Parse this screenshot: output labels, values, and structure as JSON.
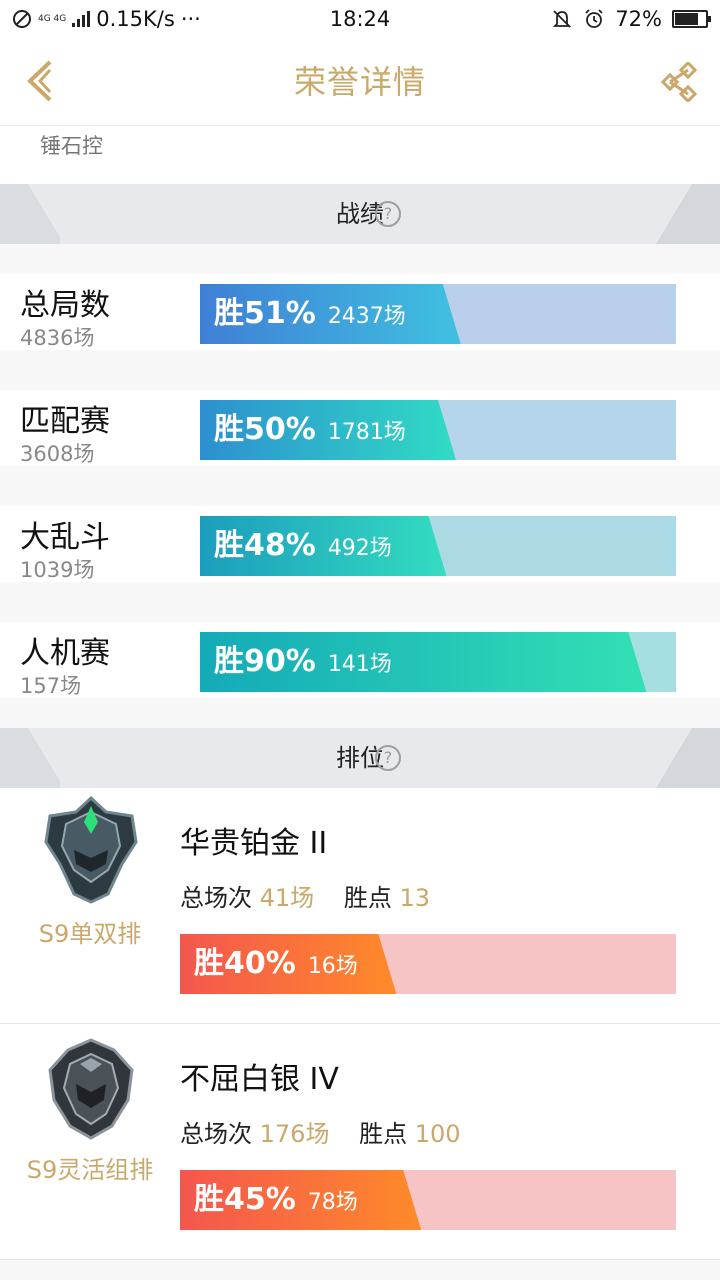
{
  "status_bar": {
    "speed": "0.15K/s",
    "dots": "···",
    "network": "4G 4G",
    "time": "18:24",
    "battery": "72%"
  },
  "header": {
    "title": "荣誉详情"
  },
  "sub_label": "锤石控",
  "sections": {
    "record": "战绩",
    "ranked": "排位",
    "help": "?"
  },
  "modes": [
    {
      "name": "总局数",
      "count": "4836场",
      "win_pct": "胜51%",
      "win_games": "2437场",
      "win_rate": 51,
      "grad_from": "#3f7fd6",
      "grad_to": "#3fc1e0",
      "track": "#b9cfec"
    },
    {
      "name": "匹配赛",
      "count": "3608场",
      "win_pct": "胜50%",
      "win_games": "1781场",
      "win_rate": 50,
      "grad_from": "#2d8fd0",
      "grad_to": "#30dcc4",
      "track": "#b4d5ea"
    },
    {
      "name": "大乱斗",
      "count": "1039场",
      "win_pct": "胜48%",
      "win_games": "492场",
      "win_rate": 48,
      "grad_from": "#1c9dbd",
      "grad_to": "#34dcc0",
      "track": "#abd9e4"
    },
    {
      "name": "人机赛",
      "count": "157场",
      "win_pct": "胜90%",
      "win_games": "141场",
      "win_rate": 90,
      "grad_from": "#14aab8",
      "grad_to": "#33e0b4",
      "track": "#a6dfe2"
    }
  ],
  "ranks": [
    {
      "queue": "S9单双排",
      "tier": "华贵铂金 II",
      "total_label": "总场次",
      "total_value": "41场",
      "points_label": "胜点",
      "points_value": "13",
      "win_pct": "胜40%",
      "win_games": "16场",
      "win_rate": 40,
      "badge_accent": "#2ee07a"
    },
    {
      "queue": "S9灵活组排",
      "tier": "不屈白银 IV",
      "total_label": "总场次",
      "total_value": "176场",
      "points_label": "胜点",
      "points_value": "100",
      "win_pct": "胜45%",
      "win_games": "78场",
      "win_rate": 45,
      "badge_accent": "#9aa3ab"
    }
  ],
  "colors": {
    "accent_gold": "#c9a86a",
    "rank_bar_track": "#f6c4c4"
  }
}
